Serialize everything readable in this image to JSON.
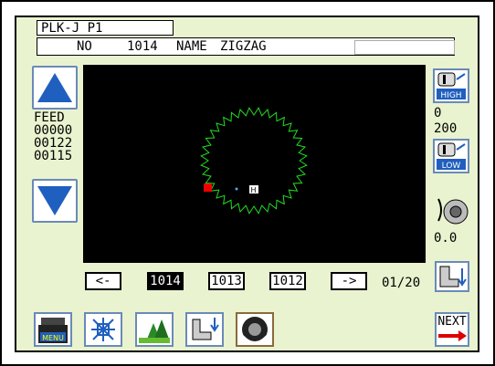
{
  "title": "PLK-J P1",
  "info": {
    "no_label": "NO",
    "no_value": "1014",
    "name_label": "NAME",
    "name_value": "ZIGZAG"
  },
  "feed": {
    "label": "FEED",
    "lines": [
      "00000",
      "00122",
      "00115"
    ]
  },
  "pages": {
    "prev": "<-",
    "items": [
      "1014",
      "1013",
      "1012"
    ],
    "next": "->",
    "indicator": "01/20"
  },
  "right": {
    "high_label": "HIGH",
    "low_label": "LOW",
    "value_a": "0",
    "value_b": "200",
    "tension": "0.0"
  },
  "bottom": {
    "menu_label": "MENU",
    "next_label": "NEXT"
  },
  "colors": {
    "panel": "#e9f3cf",
    "canvas": "#000000",
    "stitch": "#22dd22",
    "accent": "#1f5fbf"
  },
  "canvas_markers": {
    "home_label": "H"
  }
}
